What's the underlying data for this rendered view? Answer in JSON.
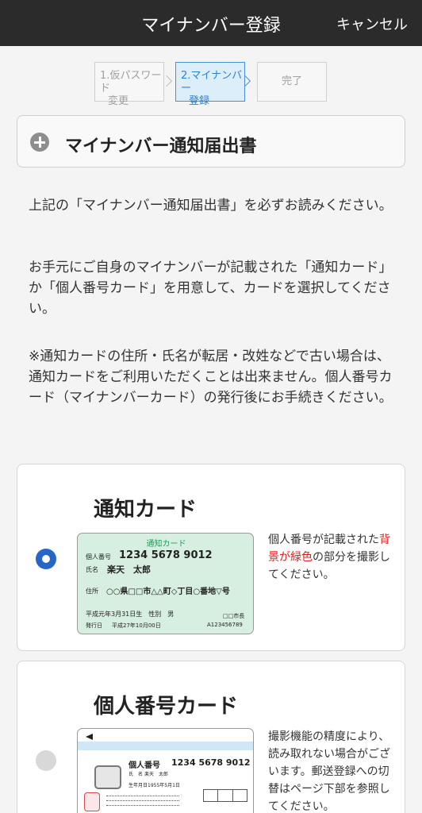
{
  "header": {
    "title": "マイナンバー登録",
    "cancel_label": "キャンセル"
  },
  "steps": [
    {
      "line1": "1.仮パスワード",
      "line2": "変更",
      "state": "done"
    },
    {
      "line1": "2.マイナンバー",
      "line2": "登録",
      "state": "current"
    },
    {
      "line1": "完了",
      "line2": "",
      "state": "pending"
    }
  ],
  "accordion": {
    "label": "マイナンバー通知届出書",
    "icon": "plus-circle-icon"
  },
  "instructions": {
    "p1": "上記の「マイナンバー通知届出書」を必ずお読みください。",
    "p2": "お手元にご自身のマイナンバーが記載された「通知カード」か「個人番号カード」を用意して、カードを選択してください。",
    "p3": "※通知カードの住所・氏名が転居・改姓などで古い場合は、通知カードをご利用いただくことは出来ません。個人番号カード（マイナンバーカード）の発行後にお手続きください。"
  },
  "options": {
    "notification_card": {
      "title": "通知カード",
      "selected": true,
      "desc_before": "個人番号が記載された",
      "desc_highlight": "背景が緑色",
      "desc_after": "の部分を撮影してください。",
      "highlight_color": "#e02020",
      "card": {
        "heading": "通知カード",
        "number_label": "個人番号",
        "number": "1234 5678 9012",
        "name_label": "氏名",
        "name": "楽天　太郎",
        "address_label": "住所",
        "address": "○○県□□市△△町◇丁目○番地▽号",
        "birth": "平成元年3月31日生　性別　男",
        "issuer": "□□市長",
        "issue_label": "発行日",
        "issue_date": "平成27年10月00日",
        "serial": "A123456789"
      }
    },
    "individual_card": {
      "title": "個人番号カード",
      "selected": false,
      "desc": "撮影機能の精度により、読み取れない場合がございます。郵送登録への切替はページ下部を参照してください。",
      "card": {
        "number_label": "個人番号",
        "number": "1234 5678 9012",
        "name_label": "氏　名",
        "name": "楽天　太郎",
        "birth_label": "生年月日",
        "birth": "1955年5月1日"
      }
    }
  }
}
